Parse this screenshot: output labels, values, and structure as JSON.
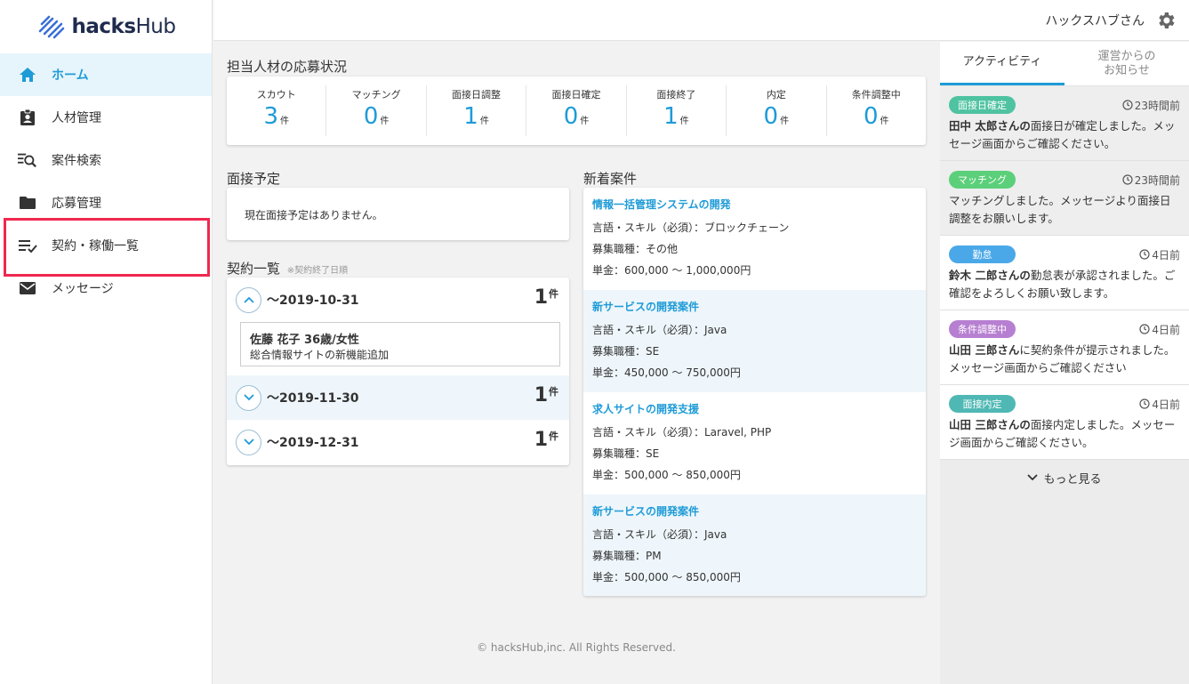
{
  "sidebar": {
    "logo_text_bold": "hacks",
    "logo_text_rest": "Hub",
    "items": [
      {
        "label": "ホーム"
      },
      {
        "label": "人材管理"
      },
      {
        "label": "案件検索"
      },
      {
        "label": "応募管理"
      },
      {
        "label": "契約・稼働一覧"
      },
      {
        "label": "メッセージ"
      }
    ]
  },
  "header": {
    "user": "ハックスハブさん"
  },
  "status": {
    "title": "担当人材の応募状況",
    "unit": "件",
    "cells": [
      {
        "label": "スカウト",
        "value": "3"
      },
      {
        "label": "マッチング",
        "value": "0"
      },
      {
        "label": "面接日調整",
        "value": "1"
      },
      {
        "label": "面接日確定",
        "value": "0"
      },
      {
        "label": "面接終了",
        "value": "1"
      },
      {
        "label": "内定",
        "value": "0"
      },
      {
        "label": "条件調整中",
        "value": "0"
      }
    ]
  },
  "interview": {
    "title": "面接予定",
    "empty": "現在面接予定はありません。"
  },
  "contracts": {
    "title": "契約一覧",
    "note": "※契約終了日順",
    "unit": "件",
    "rows": [
      {
        "date": "～2019-10-31",
        "count": "1",
        "person": "佐藤 花子 36歳/女性",
        "project": "総合情報サイトの新機能追加"
      },
      {
        "date": "～2019-11-30",
        "count": "1"
      },
      {
        "date": "～2019-12-31",
        "count": "1"
      }
    ]
  },
  "projects": {
    "title": "新着案件",
    "items": [
      {
        "title": "情報一括管理システムの開発",
        "skill": "言語・スキル（必須）：ブロックチェーン",
        "role": "募集職種：その他",
        "price": "単金：600,000 ～ 1,000,000円"
      },
      {
        "title": "新サービスの開発案件",
        "skill": "言語・スキル（必須）：Java",
        "role": "募集職種：SE",
        "price": "単金：450,000 ～ 750,000円"
      },
      {
        "title": "求人サイトの開発支援",
        "skill": "言語・スキル（必須）：Laravel, PHP",
        "role": "募集職種：SE",
        "price": "単金：500,000 ～ 850,000円"
      },
      {
        "title": "新サービスの開発案件",
        "skill": "言語・スキル（必須）：Java",
        "role": "募集職種：PM",
        "price": "単金：500,000 ～ 850,000円"
      }
    ]
  },
  "footer": "© hacksHub,inc. All Rights Reserved.",
  "right": {
    "tab_activity": "アクティビティ",
    "tab_notice_1": "運営からの",
    "tab_notice_2": "お知らせ",
    "activities": [
      {
        "badge": "面接日確定",
        "color": "#4fc3a1",
        "time": "23時間前",
        "bold": "田中 太郎さんの",
        "text": "面接日が確定しました。メッセージ画面からご確認ください。"
      },
      {
        "badge": "マッチング",
        "color": "#5ccf7a",
        "time": "23時間前",
        "bold": "",
        "text": "マッチングしました。メッセージより面接日調整をお願いします。"
      },
      {
        "badge": "勤怠",
        "color": "#4aa8e8",
        "time": "4日前",
        "bold": "鈴木 二郎さんの",
        "text": "勤怠表が承認されました。ご確認をよろしくお願い致します。"
      },
      {
        "badge": "条件調整中",
        "color": "#b77fd1",
        "time": "4日前",
        "bold": "山田 三郎さん",
        "text": "に契約条件が提示されました。メッセージ画面からご確認ください"
      },
      {
        "badge": "面接内定",
        "color": "#4fb8b4",
        "time": "4日前",
        "bold": "山田 三郎さんの",
        "text": "面接内定しました。メッセージ画面からご確認ください。"
      }
    ],
    "more": "もっと見る"
  },
  "colors": {
    "accent": "#1e9bd7",
    "highlight": "#f0284f"
  }
}
